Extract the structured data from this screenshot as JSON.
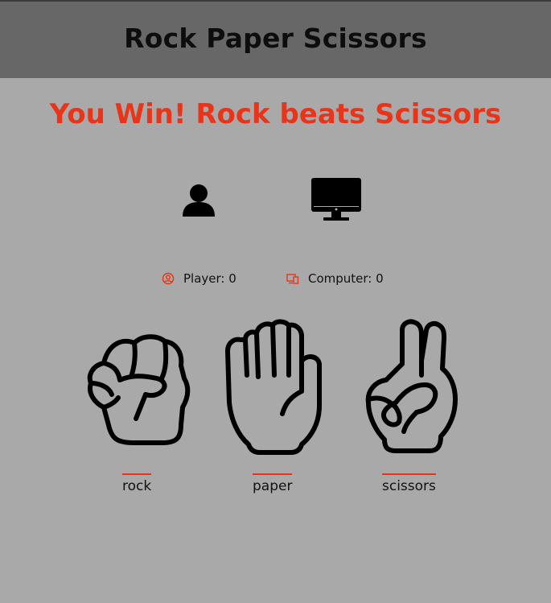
{
  "header": {
    "title": "Rock Paper Scissors"
  },
  "result": {
    "message": "You Win! Rock beats Scissors",
    "color": "#e8351a"
  },
  "avatars": {
    "player_icon": "user-icon",
    "computer_icon": "desktop-computer-icon"
  },
  "scores": {
    "player_label": "Player: 0",
    "computer_label": "Computer: 0"
  },
  "choices": [
    {
      "id": "rock",
      "label": "rock",
      "icon": "fist-icon"
    },
    {
      "id": "paper",
      "label": "paper",
      "icon": "open-hand-icon"
    },
    {
      "id": "scissors",
      "label": "scissors",
      "icon": "peace-hand-icon"
    }
  ],
  "colors": {
    "background": "#a9a9a9",
    "header_bg": "#676767",
    "accent": "#e8351a"
  }
}
